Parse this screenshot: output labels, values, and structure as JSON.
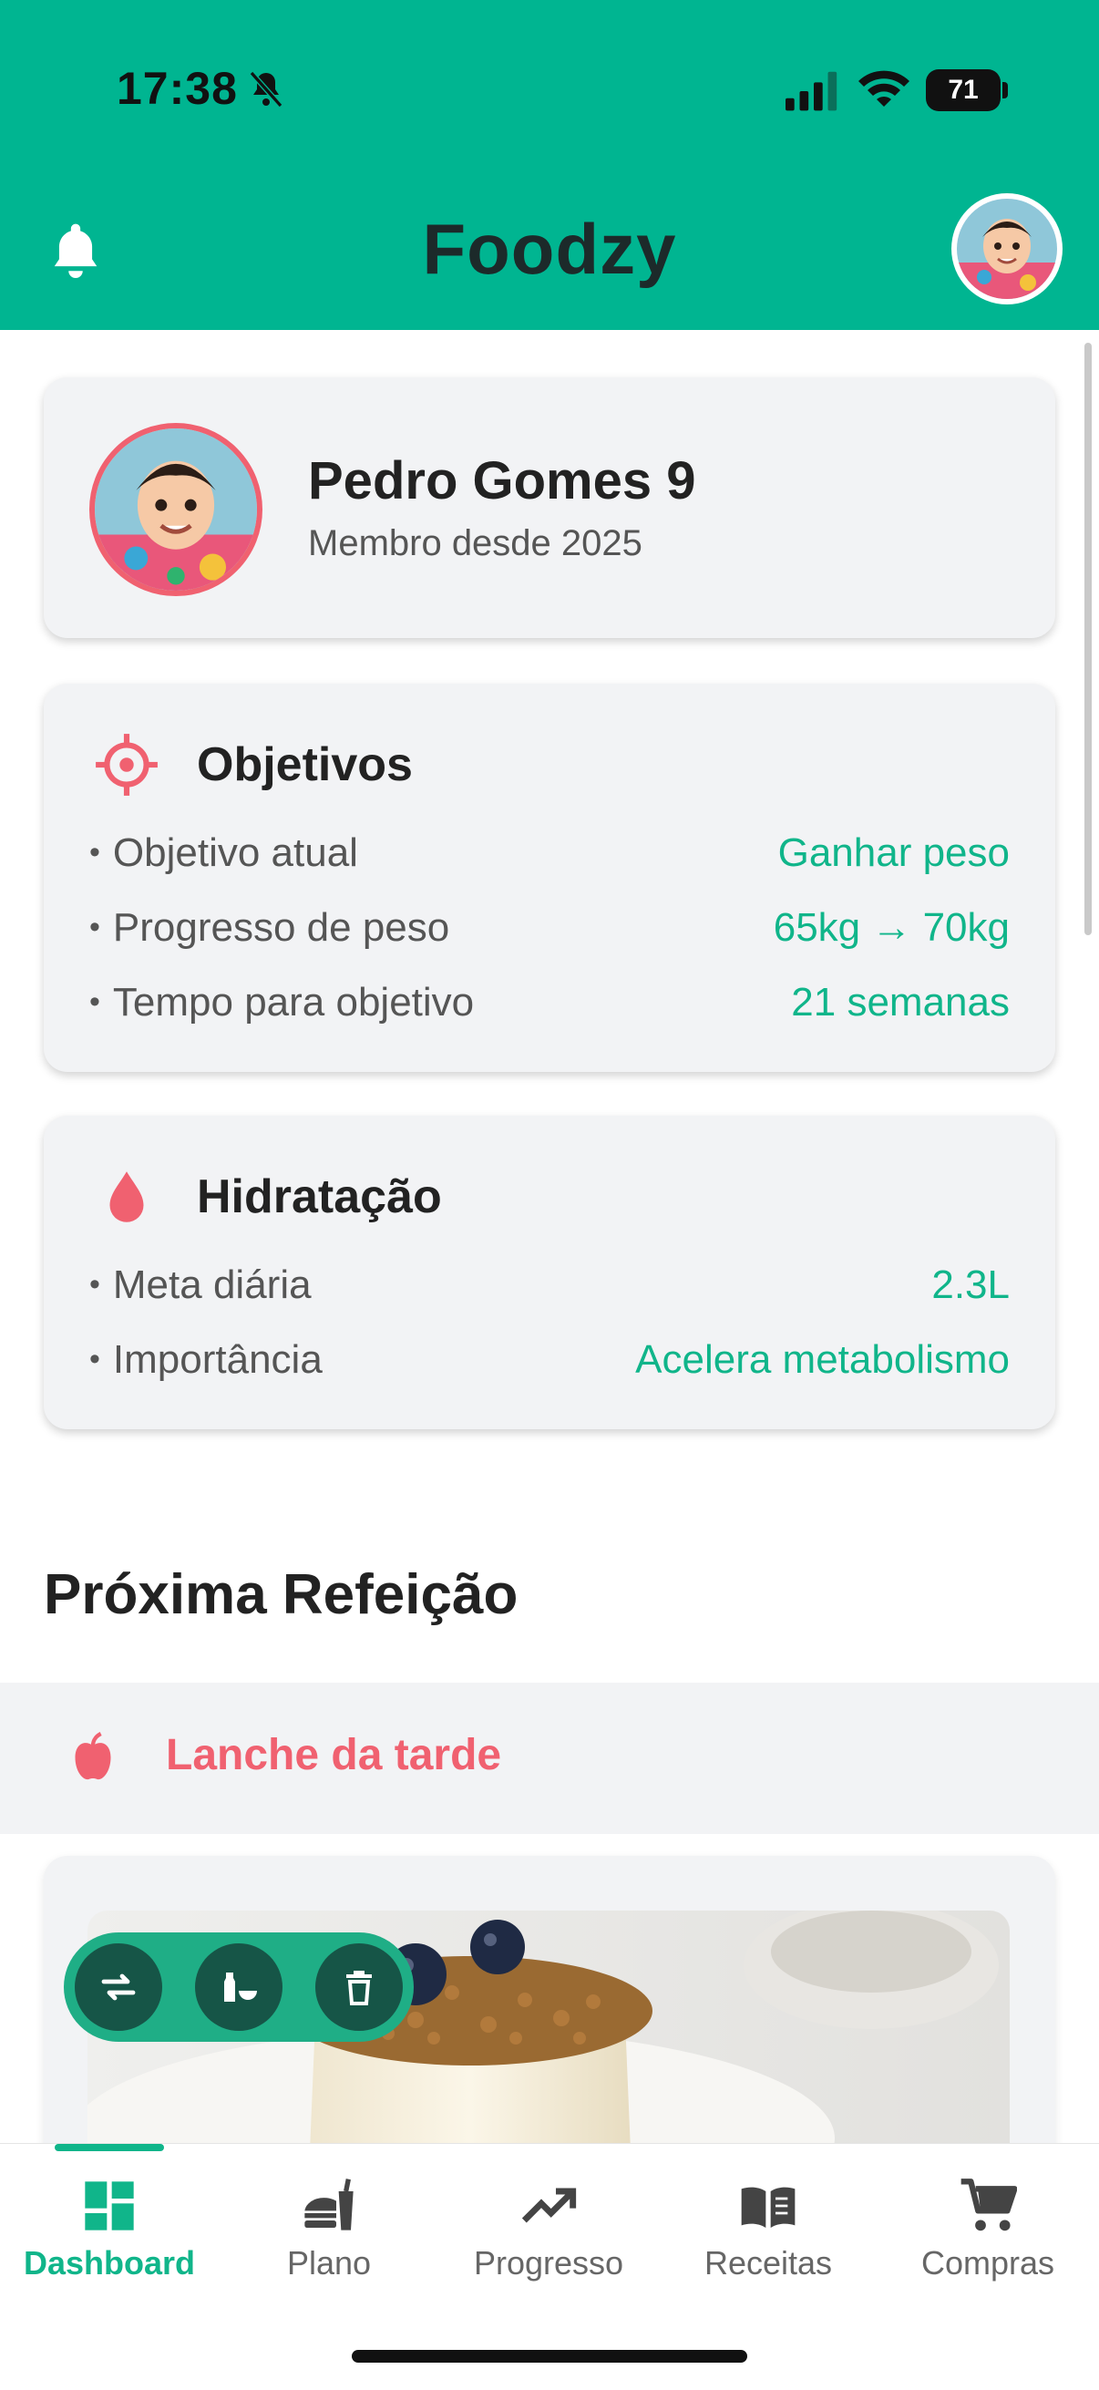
{
  "status_bar": {
    "time": "17:38",
    "battery": "71"
  },
  "header": {
    "title": "Foodzy"
  },
  "profile": {
    "name": "Pedro Gomes 9",
    "member_since": "Membro desde 2025"
  },
  "objectives": {
    "title": "Objetivos",
    "rows": [
      {
        "label": "Objetivo atual",
        "value": "Ganhar peso"
      },
      {
        "label": "Progresso de peso",
        "value": "65kg → 70kg"
      },
      {
        "label": "Tempo para objetivo",
        "value": "21 semanas"
      }
    ]
  },
  "hydration": {
    "title": "Hidratação",
    "rows": [
      {
        "label": "Meta diária",
        "value": "2.3L"
      },
      {
        "label": "Importância",
        "value": "Acelera metabolismo"
      }
    ]
  },
  "next_meal": {
    "section_title": "Próxima Refeição",
    "meal_label": "Lanche da tarde"
  },
  "bottom_nav": [
    {
      "label": "Dashboard",
      "icon": "dashboard-icon",
      "active": true
    },
    {
      "label": "Plano",
      "icon": "meal-plan-icon",
      "active": false
    },
    {
      "label": "Progresso",
      "icon": "trending-up-icon",
      "active": false
    },
    {
      "label": "Receitas",
      "icon": "book-icon",
      "active": false
    },
    {
      "label": "Compras",
      "icon": "cart-icon",
      "active": false
    }
  ],
  "colors": {
    "brand": "#00b591",
    "accent_text": "#10b58a",
    "meal_label": "#f06170",
    "action_pill": "#1fae86"
  }
}
